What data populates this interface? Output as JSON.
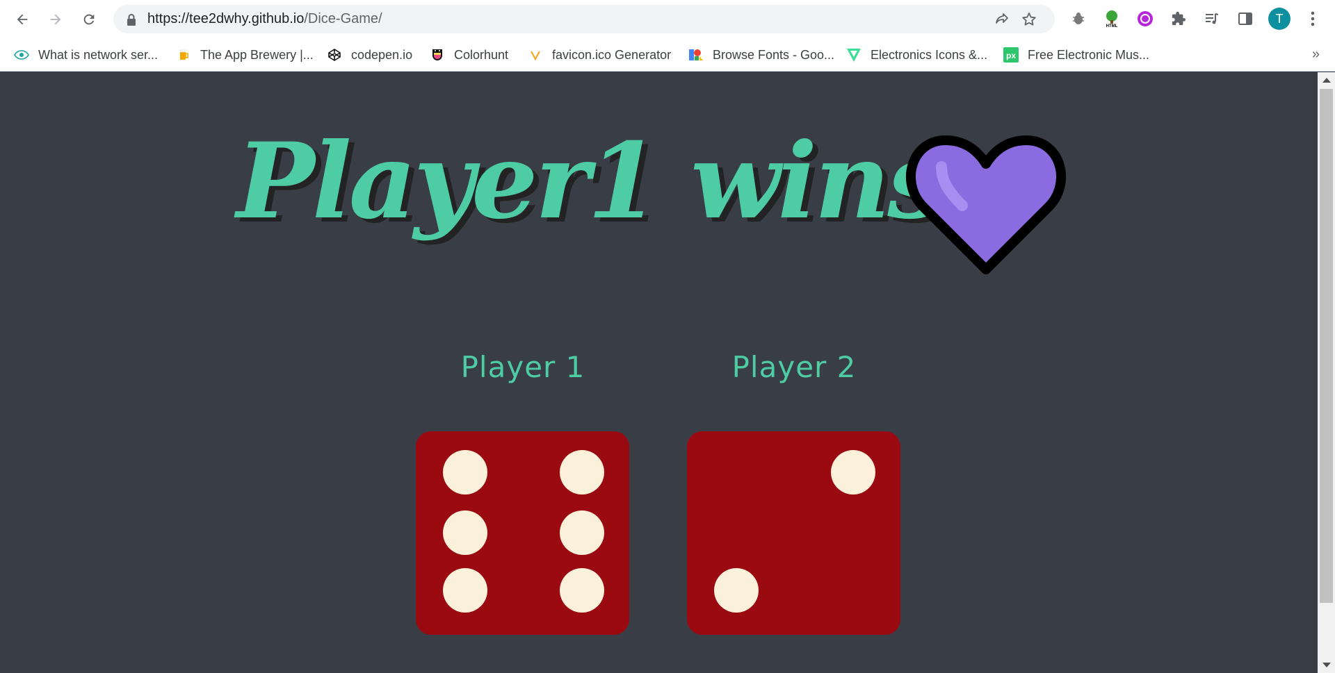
{
  "browser": {
    "url_host": "https://tee2dwhy.github.io",
    "url_path": "/Dice-Game/",
    "avatar_letter": "T",
    "accent": "#0c8f9f"
  },
  "bookmarks": [
    {
      "label": "What is network ser...",
      "icon": "eye-icon"
    },
    {
      "label": "The App Brewery |...",
      "icon": "app-brewery-icon"
    },
    {
      "label": "codepen.io",
      "icon": "codepen-icon"
    },
    {
      "label": "Colorhunt",
      "icon": "colorhunt-icon"
    },
    {
      "label": "favicon.ico Generator",
      "icon": "favicon-generator-icon"
    },
    {
      "label": "Browse Fonts - Goo...",
      "icon": "google-fonts-icon"
    },
    {
      "label": "Electronics Icons &...",
      "icon": "electronics-icons-icon"
    },
    {
      "label": "Free Electronic Mus...",
      "icon": "pixabay-icon"
    }
  ],
  "page": {
    "headline": "Player1 wins",
    "headline_emoji": "purple-heart-icon",
    "players": [
      {
        "label": "Player 1",
        "die_value": 6
      },
      {
        "label": "Player 2",
        "die_value": 2
      }
    ],
    "colors": {
      "background": "#393e46",
      "text": "#4ecca3",
      "die": "#9b0a10",
      "pip": "#fbf0d9",
      "heart": "#8a6be0"
    }
  }
}
